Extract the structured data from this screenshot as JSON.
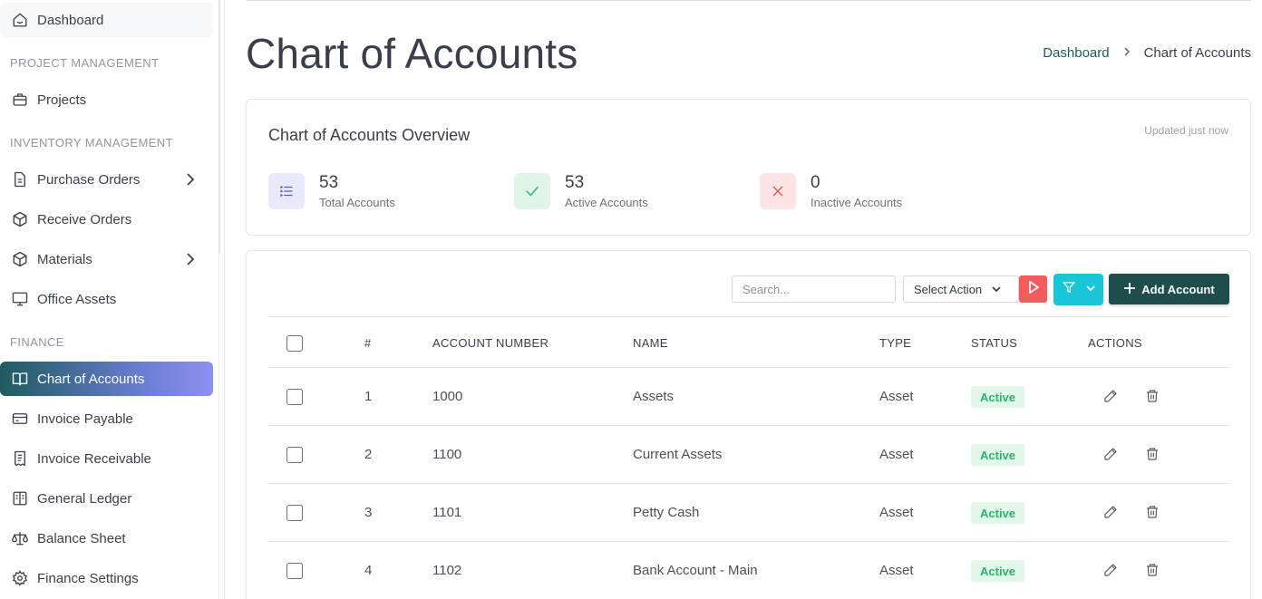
{
  "sidebar": {
    "dashboard": "Dashboard",
    "sections": {
      "project": "PROJECT MANAGEMENT",
      "inventory": "INVENTORY MANAGEMENT",
      "finance": "FINANCE"
    },
    "items": {
      "projects": "Projects",
      "purchase_orders": "Purchase Orders",
      "receive_orders": "Receive Orders",
      "materials": "Materials",
      "office_assets": "Office Assets",
      "chart_of_accounts": "Chart of Accounts",
      "invoice_payable": "Invoice Payable",
      "invoice_receivable": "Invoice Receivable",
      "general_ledger": "General Ledger",
      "balance_sheet": "Balance Sheet",
      "finance_settings": "Finance Settings"
    },
    "active_item": "chart_of_accounts"
  },
  "header": {
    "title": "Chart of Accounts",
    "breadcrumb": {
      "link": "Dashboard",
      "current": "Chart of Accounts"
    }
  },
  "overview": {
    "title": "Chart of Accounts Overview",
    "updated": "Updated just now",
    "stats": [
      {
        "value": "53",
        "label": "Total Accounts",
        "icon": "list-icon",
        "color": "#6b6fd6",
        "bg": "#e9e9fb"
      },
      {
        "value": "53",
        "label": "Active Accounts",
        "icon": "check-icon",
        "color": "#2fb56c",
        "bg": "#def5e7"
      },
      {
        "value": "0",
        "label": "Inactive Accounts",
        "icon": "x-icon",
        "color": "#f04b4b",
        "bg": "#fde4e4"
      }
    ]
  },
  "toolbar": {
    "search_placeholder": "Search...",
    "select_action": "Select Action",
    "add_button": "Add Account"
  },
  "table": {
    "columns": [
      "#",
      "ACCOUNT NUMBER",
      "NAME",
      "TYPE",
      "STATUS",
      "ACTIONS"
    ],
    "rows": [
      {
        "index": "1",
        "account_number": "1000",
        "name": "Assets",
        "type": "Asset",
        "status": "Active"
      },
      {
        "index": "2",
        "account_number": "1100",
        "name": "Current Assets",
        "type": "Asset",
        "status": "Active"
      },
      {
        "index": "3",
        "account_number": "1101",
        "name": "Petty Cash",
        "type": "Asset",
        "status": "Active"
      },
      {
        "index": "4",
        "account_number": "1102",
        "name": "Bank Account - Main",
        "type": "Asset",
        "status": "Active"
      }
    ]
  },
  "colors": {
    "accent_dark": "#1d4e4c",
    "filter": "#19c6d8",
    "run": "#f25c5c",
    "status_active": "#29b36b"
  }
}
